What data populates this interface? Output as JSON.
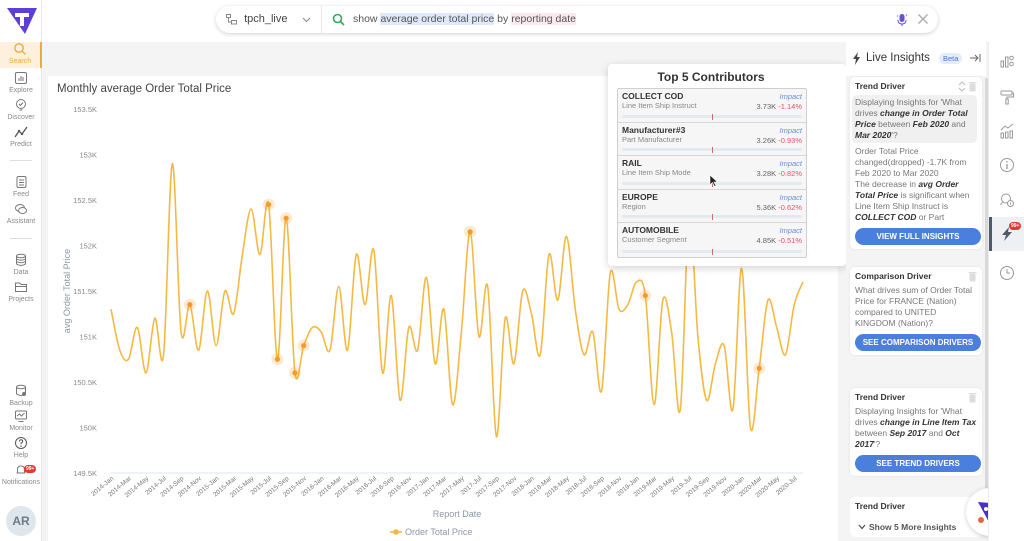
{
  "leftnav": {
    "items": [
      {
        "label": "Search",
        "icon": "search-icon",
        "active": true
      },
      {
        "label": "Explore",
        "icon": "explore-icon"
      },
      {
        "label": "Discover",
        "icon": "discover-icon"
      },
      {
        "label": "Predict",
        "icon": "predict-icon"
      },
      {
        "label": "Feed",
        "icon": "feed-icon"
      },
      {
        "label": "Assistant",
        "icon": "assistant-icon"
      },
      {
        "label": "Data",
        "icon": "database-icon"
      },
      {
        "label": "Projects",
        "icon": "folder-icon"
      },
      {
        "label": "Backup",
        "icon": "backup-icon"
      },
      {
        "label": "Monitor",
        "icon": "monitor-icon"
      },
      {
        "label": "Help",
        "icon": "help-icon"
      },
      {
        "label": "Notifications",
        "icon": "bell-icon",
        "badge": "99+"
      }
    ],
    "avatar_initials": "AR"
  },
  "search": {
    "datasource": "tpch_live",
    "query_parts": [
      {
        "text": "show ",
        "type": "keyword"
      },
      {
        "text": "average order total price",
        "type": "measure"
      },
      {
        "text": " by ",
        "type": "keyword"
      },
      {
        "text": "reporting date",
        "type": "dimension"
      }
    ]
  },
  "chart_data": {
    "type": "line",
    "title": "Monthly average Order Total Price",
    "xlabel": "Report Date",
    "ylabel": "avg Order Total Price",
    "legend": {
      "entries": [
        "Order Total Price"
      ],
      "placement": "bottom-center"
    },
    "series_color": "#f5b942",
    "highlight_color": "#f39c2a",
    "ylim": [
      149500,
      153500
    ],
    "yticks": [
      149500,
      150000,
      150500,
      151000,
      151500,
      152000,
      152500,
      153000,
      153500
    ],
    "ytick_labels": [
      "149.5K",
      "150K",
      "150.5K",
      "151K",
      "151.5K",
      "152K",
      "152.5K",
      "153K",
      "153.5K"
    ],
    "grid": false,
    "x_tick_labels": [
      "2014-Jan",
      "2014-Mar",
      "2014-May",
      "2014-Jul",
      "2014-Sep",
      "2014-Nov",
      "2015-Jan",
      "2015-Mar",
      "2015-May",
      "2015-Jul",
      "2015-Sep",
      "2015-Nov",
      "2016-Jan",
      "2016-Mar",
      "2016-May",
      "2016-Jul",
      "2016-Sep",
      "2016-Nov",
      "2017-Jan",
      "2017-Mar",
      "2017-May",
      "2017-Jul",
      "2017-Sep",
      "2017-Nov",
      "2018-Jan",
      "2018-Mar",
      "2018-May",
      "2018-Jul",
      "2018-Sep",
      "2018-Nov",
      "2019-Jan",
      "2019-Mar",
      "2019-May",
      "2019-Jul",
      "2019-Sep",
      "2019-Nov",
      "2020-Jan",
      "2020-Mar",
      "2020-May",
      "2020-Jul"
    ],
    "x": [
      "2014-Jan",
      "2014-Feb",
      "2014-Mar",
      "2014-Apr",
      "2014-May",
      "2014-Jun",
      "2014-Jul",
      "2014-Aug",
      "2014-Sep",
      "2014-Oct",
      "2014-Nov",
      "2014-Dec",
      "2015-Jan",
      "2015-Feb",
      "2015-Mar",
      "2015-Apr",
      "2015-May",
      "2015-Jun",
      "2015-Jul",
      "2015-Aug",
      "2015-Sep",
      "2015-Oct",
      "2015-Nov",
      "2015-Dec",
      "2016-Jan",
      "2016-Feb",
      "2016-Mar",
      "2016-Apr",
      "2016-May",
      "2016-Jun",
      "2016-Jul",
      "2016-Aug",
      "2016-Sep",
      "2016-Oct",
      "2016-Nov",
      "2016-Dec",
      "2017-Jan",
      "2017-Feb",
      "2017-Mar",
      "2017-Apr",
      "2017-May",
      "2017-Jun",
      "2017-Jul",
      "2017-Aug",
      "2017-Sep",
      "2017-Oct",
      "2017-Nov",
      "2017-Dec",
      "2018-Jan",
      "2018-Feb",
      "2018-Mar",
      "2018-Apr",
      "2018-May",
      "2018-Jun",
      "2018-Jul",
      "2018-Aug",
      "2018-Sep",
      "2018-Oct",
      "2018-Nov",
      "2018-Dec",
      "2019-Jan",
      "2019-Feb",
      "2019-Mar",
      "2019-Apr",
      "2019-May",
      "2019-Jun",
      "2019-Jul",
      "2019-Aug",
      "2019-Sep",
      "2019-Oct",
      "2019-Nov",
      "2019-Dec",
      "2020-Jan",
      "2020-Feb",
      "2020-Mar",
      "2020-Apr",
      "2020-May",
      "2020-Jun",
      "2020-Jul",
      "2020-Aug"
    ],
    "values": [
      151300,
      150850,
      150750,
      151100,
      150600,
      151200,
      150800,
      152900,
      151050,
      151350,
      150850,
      151500,
      150900,
      151500,
      151250,
      151900,
      152400,
      151900,
      152450,
      150750,
      152300,
      150600,
      150900,
      151100,
      151050,
      150850,
      151550,
      150850,
      151900,
      151350,
      151950,
      150600,
      151450,
      150300,
      151100,
      150850,
      151650,
      150700,
      151300,
      150250,
      151050,
      152150,
      151000,
      151550,
      149900,
      151200,
      150700,
      151500,
      151250,
      150800,
      151900,
      151400,
      152100,
      151300,
      150800,
      151050,
      150400,
      151700,
      151300,
      151350,
      151600,
      151450,
      150250,
      151400,
      151050,
      150200,
      152350,
      151000,
      150300,
      150700,
      150900,
      150200,
      151750,
      150000,
      150650,
      151400,
      151100,
      150800,
      151350,
      151600
    ],
    "highlighted_points": [
      "2014-Oct",
      "2015-Jul",
      "2015-Aug",
      "2015-Sep",
      "2015-Oct",
      "2015-Nov",
      "2017-Jun",
      "2019-Feb",
      "2020-Mar"
    ]
  },
  "contributors": {
    "title": "Top 5 Contributors",
    "impact_label": "Impact",
    "items": [
      {
        "name": "COLLECT COD",
        "dimension": "Line Item Ship Instruct",
        "value": "3.73K",
        "pct": "-1.14%"
      },
      {
        "name": "Manufacturer#3",
        "dimension": "Part Manufacturer",
        "value": "3.26K",
        "pct": "-0.93%"
      },
      {
        "name": "RAIL",
        "dimension": "Line Item Ship Mode",
        "value": "3.28K",
        "pct": "-0.82%"
      },
      {
        "name": "EUROPE",
        "dimension": "Region",
        "value": "5.36K",
        "pct": "-0.62%"
      },
      {
        "name": "AUTOMOBILE",
        "dimension": "Customer Segment",
        "value": "4.85K",
        "pct": "-0.51%"
      }
    ]
  },
  "insights": {
    "title": "Live Insights",
    "beta": "Beta",
    "cards": [
      {
        "title": "Trend Driver",
        "intro": "Displaying Insights for 'What drives ",
        "b1": "change in Order Total Price",
        "mid": " between ",
        "b2": "Feb 2020",
        "and": " and ",
        "b3": "Mar 2020",
        "end": "'?",
        "detail1": "Order Total Price changed(dropped) -1.7K from Feb 2020 to Mar 2020",
        "detail2_pre": "The decrease in ",
        "detail2_b": "avg Order Total Price",
        "detail2_mid": " is significant when Line Item Ship Instruct is ",
        "detail2_b2": "COLLECT COD",
        "detail2_end": " or Part",
        "button": "VIEW FULL INSIGHTS"
      },
      {
        "title": "Comparison Driver",
        "body": "What drives sum of Order Total Price for FRANCE (Nation) compared to UNITED KINGDOM (Nation)?",
        "button": "SEE COMPARISON DRIVERS"
      },
      {
        "title": "Trend Driver",
        "intro": "Displaying Insights for 'What drives ",
        "b1": "change in Line Item Tax",
        "mid": " between ",
        "b2": "Sep 2017",
        "and": " and ",
        "b3": "Oct 2017",
        "end": "'?",
        "button": "SEE TREND DRIVERS"
      },
      {
        "title": "Trend Driver"
      }
    ],
    "show_more": "Show 5 More Insights"
  },
  "rail": {
    "items": [
      {
        "icon": "chart-type-icon"
      },
      {
        "icon": "paint-roller-icon"
      },
      {
        "icon": "analytics-icon"
      },
      {
        "icon": "info-icon"
      },
      {
        "icon": "search-insight-icon"
      },
      {
        "icon": "lightning-icon",
        "active": true,
        "badge": "99+"
      },
      {
        "icon": "history-icon"
      }
    ]
  }
}
